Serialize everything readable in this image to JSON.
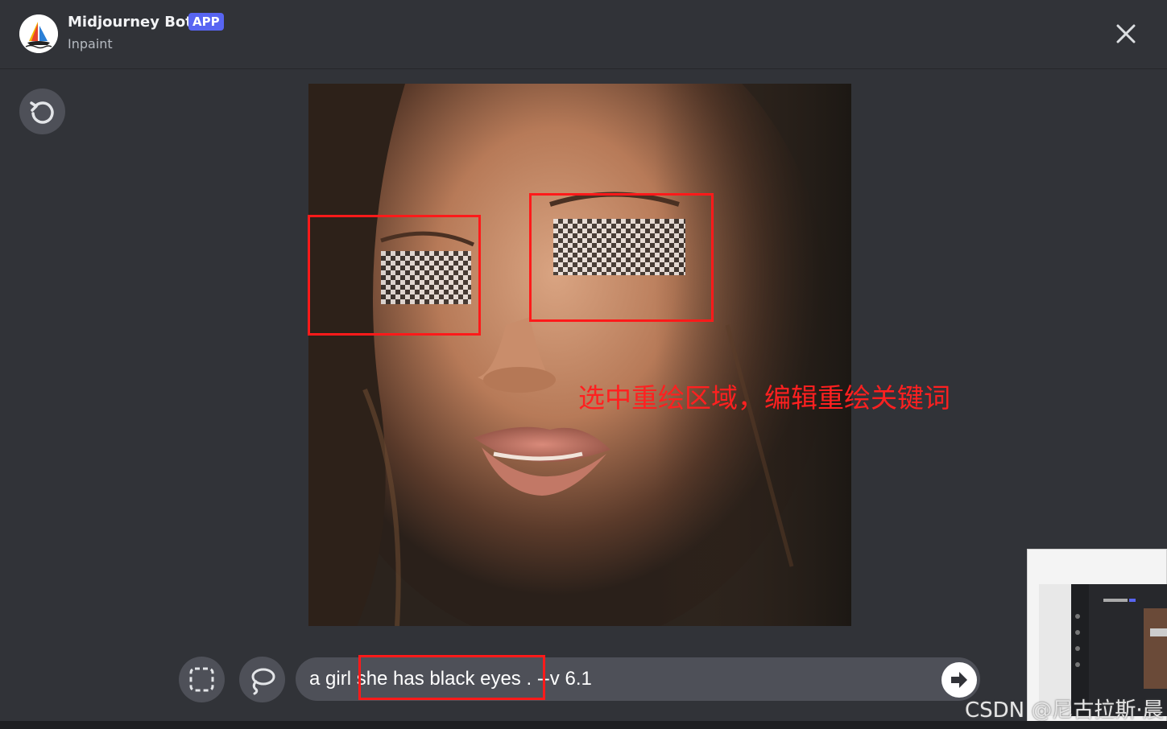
{
  "header": {
    "bot_name": "Midjourney Bot",
    "badge": "APP",
    "subtitle": "Inpaint"
  },
  "icons": {
    "avatar": "midjourney-sailboat-icon",
    "close": "close-icon",
    "undo": "undo-icon",
    "rect_select": "rectangle-select-icon",
    "lasso": "lasso-icon",
    "send": "send-arrow-icon"
  },
  "annotation": {
    "text": "选中重绘区域，编辑重绘关键词"
  },
  "prompt": {
    "part1": "a girl ",
    "part2": "she has black eyes",
    "part3": " . --v 6.1"
  },
  "watermark": "CSDN @尼古拉斯·晨",
  "colors": {
    "background": "#313338",
    "accent": "#5865f2",
    "annotation_red": "#ff1a1a"
  }
}
